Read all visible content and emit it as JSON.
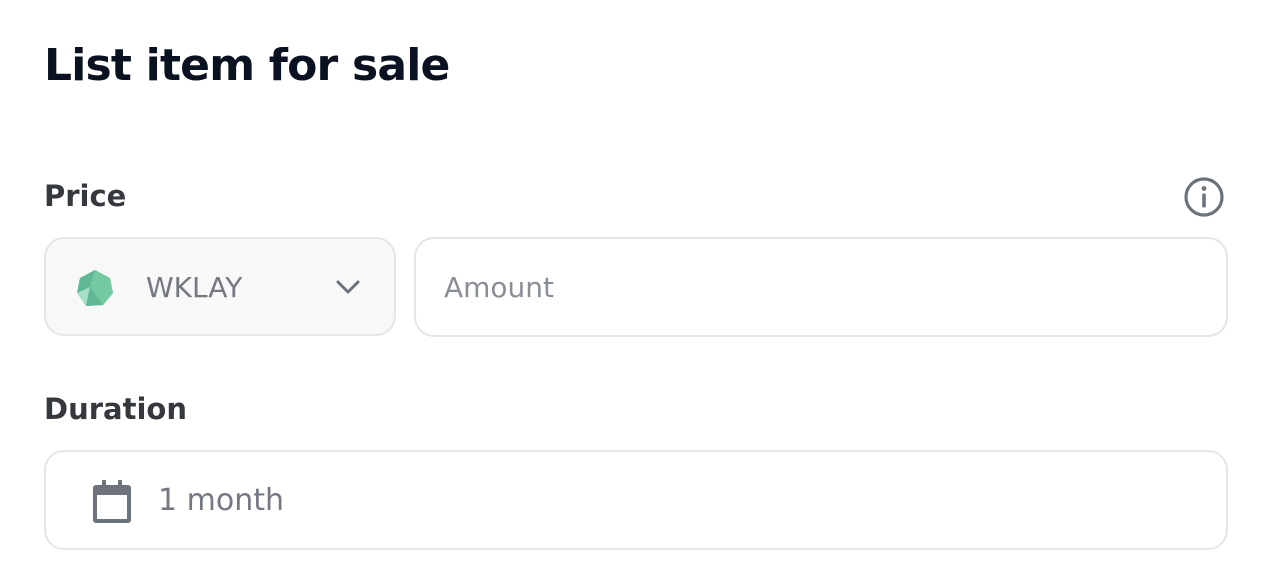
{
  "page_title": "List item for sale",
  "price": {
    "label": "Price",
    "info_icon": "info-circle-icon",
    "currency": {
      "selected": "WKLAY",
      "token_icon": "klay-token-icon",
      "token_colors": [
        "#7fd0ad",
        "#5fb893",
        "#a7e0c6"
      ]
    },
    "amount": {
      "placeholder": "Amount",
      "value": ""
    }
  },
  "duration": {
    "label": "Duration",
    "icon": "calendar-icon",
    "value": "1 month"
  },
  "colors": {
    "title": "#0a1120",
    "label": "#35383d",
    "muted_text": "#737881",
    "border": "#e6e6e6",
    "select_bg": "#f8f8f8"
  }
}
